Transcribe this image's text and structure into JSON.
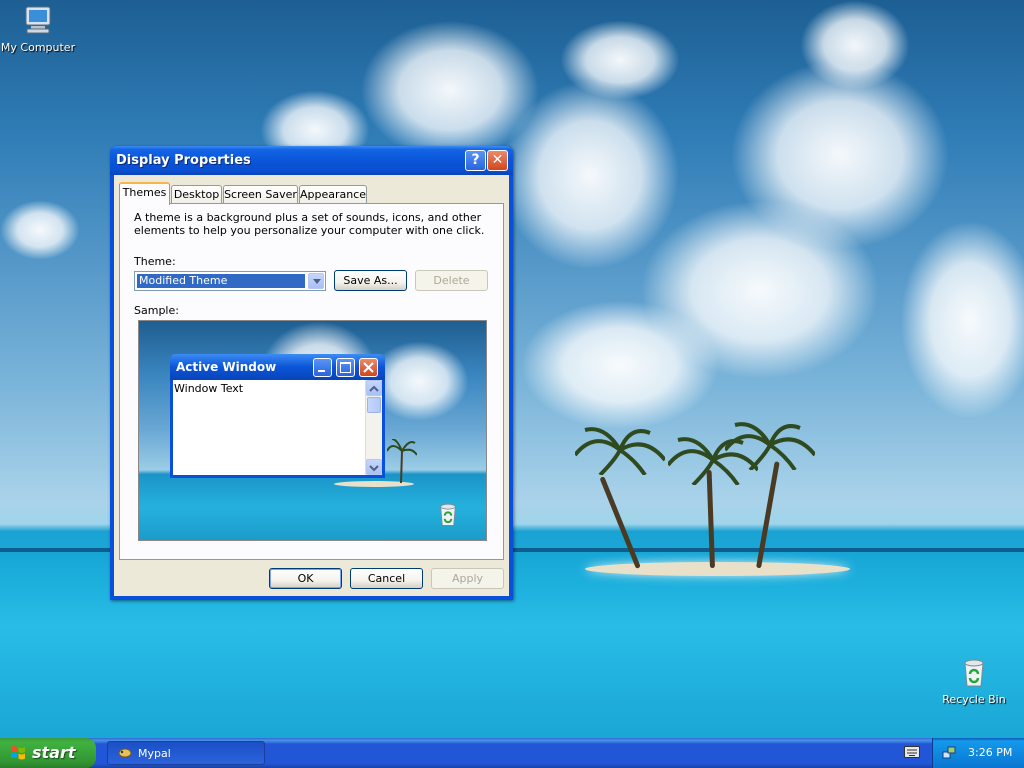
{
  "desktop": {
    "icons": [
      {
        "label": "My Computer",
        "icon": "my-computer-icon"
      },
      {
        "label": "Recycle Bin",
        "icon": "recycle-bin-icon"
      }
    ]
  },
  "window": {
    "title": "Display Properties",
    "help_glyph": "?",
    "close_glyph": "✕",
    "tabs": [
      "Themes",
      "Desktop",
      "Screen Saver",
      "Appearance"
    ],
    "active_tab": "Themes",
    "description": "A theme is a background plus a set of sounds, icons, and other elements to help you personalize your computer with one click.",
    "theme_label": "Theme:",
    "theme_value": "Modified Theme",
    "save_as_label": "Save As...",
    "delete_label": "Delete",
    "sample_label": "Sample:",
    "sample": {
      "window_title": "Active Window",
      "window_text": "Window Text"
    },
    "ok_label": "OK",
    "cancel_label": "Cancel",
    "apply_label": "Apply"
  },
  "taskbar": {
    "start_label": "start",
    "task_label": "Mypal",
    "time": "3:26 PM"
  },
  "colors": {
    "title_blue": "#0a55d8",
    "taskbar_blue": "#2157d7",
    "start_green": "#3fb23f"
  }
}
